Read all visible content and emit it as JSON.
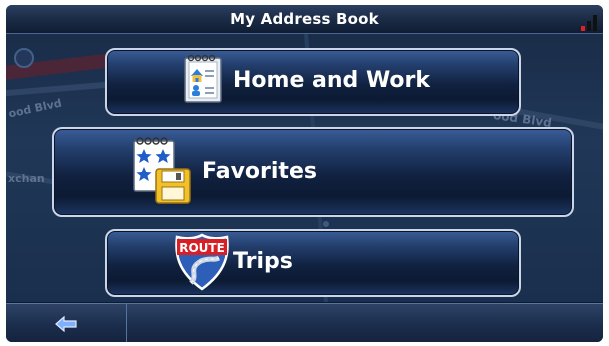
{
  "header": {
    "title": "My Address Book"
  },
  "map_labels": {
    "road_left": "ood Blvd",
    "road_right": "ood Blvd",
    "exchange": "xchan"
  },
  "menu": [
    {
      "label": "Home and Work",
      "icon": "address-book-icon"
    },
    {
      "label": "Favorites",
      "icon": "favorites-icon"
    },
    {
      "label": "Trips",
      "icon": "route-sign-icon",
      "icon_text": "ROUTE"
    }
  ],
  "footer": {
    "back_icon": "back-arrow-icon"
  },
  "colors": {
    "accent": "#2a4a80",
    "border": "#c9d5e8",
    "background": "#0e1b2e"
  }
}
